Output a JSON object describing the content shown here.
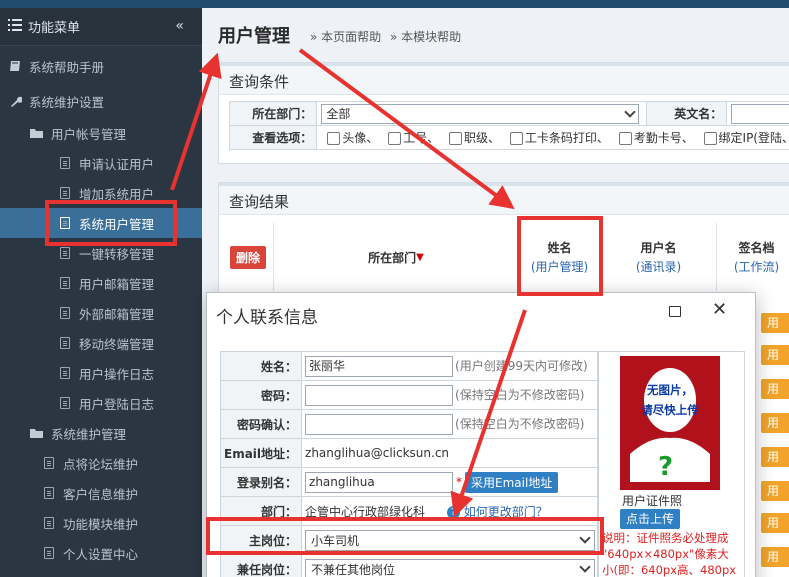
{
  "sidebar": {
    "header": "功能菜单",
    "collapse": "«",
    "items": [
      {
        "label": "系统帮助手册"
      },
      {
        "label": "系统维护设置"
      },
      {
        "label": "用户帐号管理"
      },
      {
        "label": "申请认证用户"
      },
      {
        "label": "增加系统用户"
      },
      {
        "label": "系统用户管理"
      },
      {
        "label": "一键转移管理"
      },
      {
        "label": "用户邮箱管理"
      },
      {
        "label": "外部邮箱管理"
      },
      {
        "label": "移动终端管理"
      },
      {
        "label": "用户操作日志"
      },
      {
        "label": "用户登陆日志"
      },
      {
        "label": "系统维护管理"
      },
      {
        "label": "点将论坛维护"
      },
      {
        "label": "客户信息维护"
      },
      {
        "label": "功能模块维护"
      },
      {
        "label": "个人设置中心"
      }
    ]
  },
  "header": {
    "title": "用户管理",
    "help_page": "本页面帮助",
    "help_module": "本模块帮助",
    "sep": "»"
  },
  "query": {
    "title": "查询条件",
    "dept_label": "所在部门：",
    "dept_value": "全部",
    "ename_label": "英文名：",
    "options_label": "查看选项：",
    "options": [
      "头像、",
      "工号、",
      "职级、",
      "工卡条码打印、",
      "考勤卡号、",
      "绑定IP(登陆、"
    ]
  },
  "results": {
    "title": "查询结果",
    "delete": "删除",
    "col_dept": "所在部门",
    "sort_mark": "▼",
    "col_name": "姓名",
    "col_name_sub": "(用户管理)",
    "col_user": "用户名",
    "col_user_sub": "(通讯录)",
    "col_sign": "签名档",
    "col_sign_sub": "(工作流)",
    "tab_text": "用"
  },
  "dialog": {
    "title": "个人联系信息",
    "name_label": "姓名：",
    "name_value": "张丽华",
    "name_hint": "(用户创建99天内可修改)",
    "pwd_label": "密码：",
    "pwd_hint": "(保持空白为不修改密码)",
    "pwd2_label": "密码确认：",
    "pwd2_hint": "(保持空白为不修改密码)",
    "email_label": "Email地址：",
    "email_value": "zhanglihua@clicksun.cn",
    "alias_label": "登录别名：",
    "alias_value": "zhanglihua",
    "alias_star": "*",
    "alias_btn": "采用Email地址",
    "dept_label": "部门：",
    "dept_value": "企管中心行政部绿化科",
    "dept_link": "如何更改部门？",
    "post_label": "主岗位：",
    "post_value": "小车司机",
    "post2_label": "兼任岗位：",
    "post2_value": "不兼任其他岗位",
    "photo_line1": "无图片，",
    "photo_line2": "请尽快上传",
    "photo_q": "?",
    "cert_label": "用户证件照",
    "upload_btn": "点击上传",
    "note1": "说明：证件照务必处理成",
    "note2": "\"640px×480px\"像素大",
    "note3": "小(即：640px高、480px"
  },
  "colors": {
    "sidebar_bg": "#2b3643",
    "active_item": "#3a6f9a",
    "annotation_red": "#e8322f",
    "primary_blue": "#2f7fc5"
  }
}
